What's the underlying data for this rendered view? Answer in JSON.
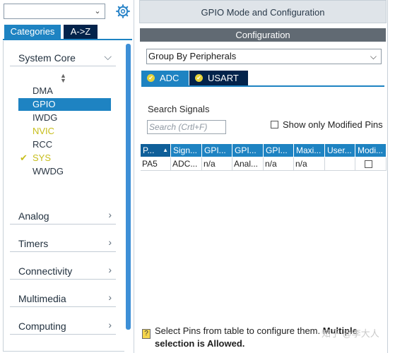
{
  "left_panel": {
    "search": {
      "value": "",
      "dropdown_glyph": "⌄"
    },
    "settings_icon": "gear-icon",
    "tabs": [
      {
        "label": "Categories",
        "active": true
      },
      {
        "label": "A->Z",
        "active": false
      }
    ],
    "categories": [
      {
        "label": "System Core",
        "expanded": true
      },
      {
        "label": "Analog",
        "expanded": false
      },
      {
        "label": "Timers",
        "expanded": false
      },
      {
        "label": "Connectivity",
        "expanded": false
      },
      {
        "label": "Multimedia",
        "expanded": false
      },
      {
        "label": "Computing",
        "expanded": false
      }
    ],
    "peripherals": [
      {
        "label": "DMA",
        "state": "normal"
      },
      {
        "label": "GPIO",
        "state": "selected"
      },
      {
        "label": "IWDG",
        "state": "normal"
      },
      {
        "label": "NVIC",
        "state": "highlighted"
      },
      {
        "label": "RCC",
        "state": "normal"
      },
      {
        "label": "SYS",
        "state": "configured"
      },
      {
        "label": "WWDG",
        "state": "normal"
      }
    ]
  },
  "right_panel": {
    "title": "GPIO Mode and Configuration",
    "config_header": "Configuration",
    "group_select": {
      "value": "Group By Peripherals"
    },
    "peripheral_tabs": [
      {
        "label": "ADC",
        "active": true
      },
      {
        "label": "USART",
        "active": false
      }
    ],
    "search_signals_label": "Search Signals",
    "search_placeholder": "Search (Crtl+F)",
    "show_modified_label": "Show only Modified Pins",
    "table": {
      "headers": [
        "P...",
        "Sign...",
        "GPI...",
        "GPI...",
        "GPI...",
        "Maxi...",
        "User...",
        "Modi..."
      ],
      "rows": [
        [
          "PA5",
          "ADC...",
          "n/a",
          "Anal...",
          "n/a",
          "n/a",
          "",
          ""
        ]
      ]
    },
    "hint_plain": "Select Pins from table to configure them.",
    "hint_bold_1": "Multiple",
    "hint_bold_2": "selection is Allowed.",
    "watermark": "知乎 @李大人"
  },
  "colors": {
    "accent": "#1e83c2",
    "dark_tab": "#03234b",
    "config_bar": "#616a73",
    "configured_mark": "#c7be1b"
  }
}
